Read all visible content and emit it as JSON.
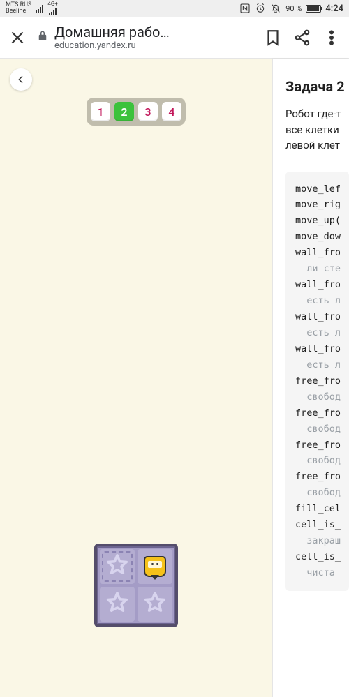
{
  "status": {
    "carrier1": "MTS RUS",
    "carrier2": "Beeline",
    "net": "4G+",
    "battery_pct": "90 %",
    "time": "4:24"
  },
  "chrome": {
    "title": "Домашняя рабо…",
    "host": "education.yandex.ru"
  },
  "tabs": {
    "items": [
      "1",
      "2",
      "3",
      "4"
    ],
    "active_index": 1
  },
  "task": {
    "title": "Задача 2",
    "desc_line1": "Робот где-т",
    "desc_line2": "все клетки",
    "desc_line3": "левой клет"
  },
  "code": {
    "lines": [
      {
        "t": "move_lef"
      },
      {
        "t": "move_rig"
      },
      {
        "t": "move_up("
      },
      {
        "t": "move_dow"
      },
      {
        "t": "wall_fro"
      },
      {
        "t": "  ли сте",
        "c": true
      },
      {
        "t": "wall_fro"
      },
      {
        "t": "  есть л",
        "c": true
      },
      {
        "t": "wall_fro"
      },
      {
        "t": "  есть л",
        "c": true
      },
      {
        "t": "wall_fro"
      },
      {
        "t": "  есть л",
        "c": true
      },
      {
        "t": "free_fro"
      },
      {
        "t": "  свобод",
        "c": true
      },
      {
        "t": "free_fro"
      },
      {
        "t": "  свобод",
        "c": true
      },
      {
        "t": "free_fro"
      },
      {
        "t": "  свобод",
        "c": true
      },
      {
        "t": "free_fro"
      },
      {
        "t": "  свобод",
        "c": true
      },
      {
        "t": "fill_cel"
      },
      {
        "t": "cell_is_"
      },
      {
        "t": "  закраш",
        "c": true
      },
      {
        "t": "cell_is_"
      },
      {
        "t": "  чиста ",
        "c": true
      }
    ]
  }
}
